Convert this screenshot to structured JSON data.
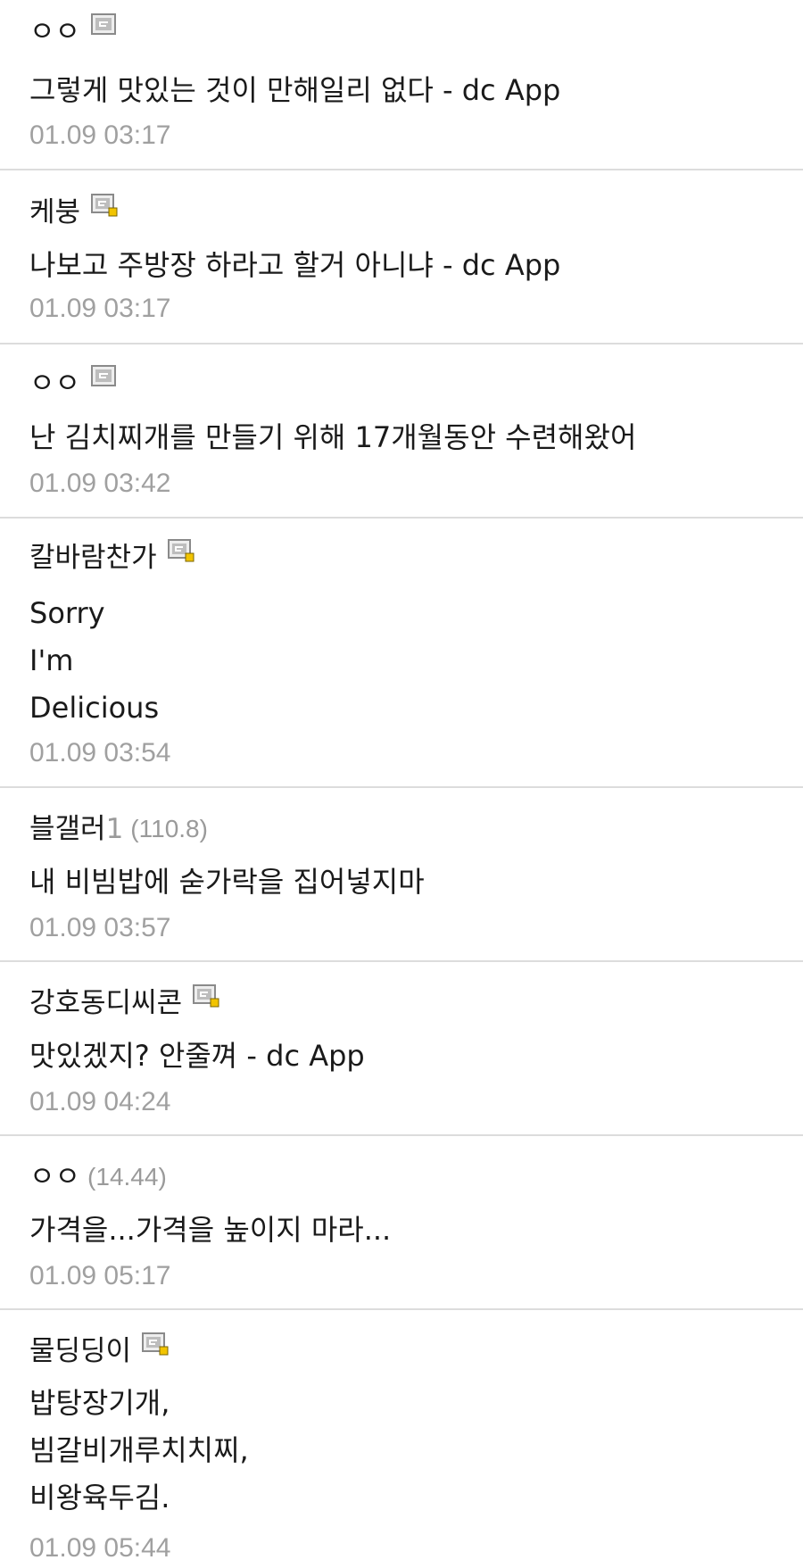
{
  "comments": [
    {
      "nickname": "ㅇㅇ",
      "icon": "gallery-icon-plain",
      "lines": [
        "그렇게 맛있는 것이 만해일리 없다 - dc App"
      ],
      "time": "01.09 03:17"
    },
    {
      "nickname": "케붕",
      "icon": "gallery-icon-fixed",
      "lines": [
        "나보고 주방장 하라고 할거 아니냐 - dc App"
      ],
      "time": "01.09 03:17"
    },
    {
      "nickname": "ㅇㅇ",
      "icon": "gallery-icon-plain",
      "lines": [
        "난 김치찌개를 만들기 위해 17개월동안 수련해왔어"
      ],
      "time": "01.09 03:42"
    },
    {
      "nickname": "칼바람찬가",
      "icon": "gallery-icon-fixed",
      "lines": [
        "Sorry",
        "I'm",
        "Delicious"
      ],
      "time": "01.09 03:54"
    },
    {
      "nickname": "블갤러",
      "nickname_suffix": "1",
      "ip": "(110.8)",
      "lines": [
        "내 비빔밥에 숟가락을 집어넣지마"
      ],
      "time": "01.09 03:57"
    },
    {
      "nickname": "강호동디씨콘",
      "icon": "gallery-icon-fixed",
      "lines": [
        "맛있겠지? 안줄껴 - dc App"
      ],
      "time": "01.09 04:24"
    },
    {
      "nickname": "ㅇㅇ",
      "ip": "(14.44)",
      "lines": [
        "가격을...가격을 높이지 마라..."
      ],
      "time": "01.09 05:17"
    },
    {
      "nickname": "물딩딩이",
      "icon": "gallery-icon-fixed",
      "lines": [
        "밥탕장기개,",
        "빔갈비개루치치찌,",
        "비왕육두김."
      ],
      "time": "01.09 05:44"
    }
  ],
  "colors": {
    "text": "#1a1a1a",
    "meta": "#a0a0a0",
    "divider": "#dcdcdc",
    "icon_badge": "#f2c400"
  }
}
